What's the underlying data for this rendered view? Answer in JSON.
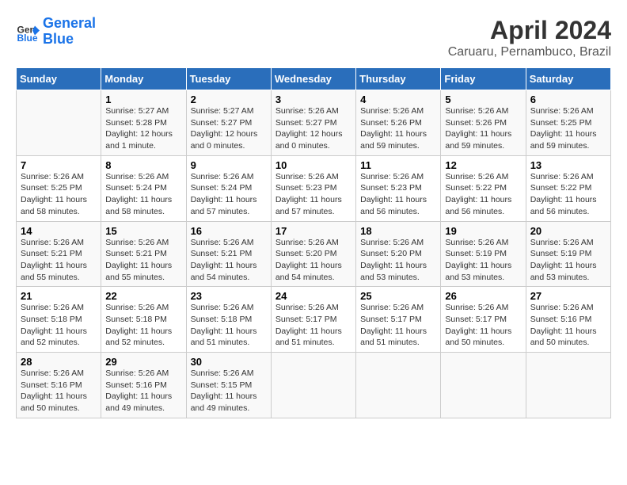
{
  "logo": {
    "line1": "General",
    "line2": "Blue"
  },
  "title": "April 2024",
  "subtitle": "Caruaru, Pernambuco, Brazil",
  "weekdays": [
    "Sunday",
    "Monday",
    "Tuesday",
    "Wednesday",
    "Thursday",
    "Friday",
    "Saturday"
  ],
  "weeks": [
    [
      {
        "day": "",
        "info": ""
      },
      {
        "day": "1",
        "info": "Sunrise: 5:27 AM\nSunset: 5:28 PM\nDaylight: 12 hours\nand 1 minute."
      },
      {
        "day": "2",
        "info": "Sunrise: 5:27 AM\nSunset: 5:27 PM\nDaylight: 12 hours\nand 0 minutes."
      },
      {
        "day": "3",
        "info": "Sunrise: 5:26 AM\nSunset: 5:27 PM\nDaylight: 12 hours\nand 0 minutes."
      },
      {
        "day": "4",
        "info": "Sunrise: 5:26 AM\nSunset: 5:26 PM\nDaylight: 11 hours\nand 59 minutes."
      },
      {
        "day": "5",
        "info": "Sunrise: 5:26 AM\nSunset: 5:26 PM\nDaylight: 11 hours\nand 59 minutes."
      },
      {
        "day": "6",
        "info": "Sunrise: 5:26 AM\nSunset: 5:25 PM\nDaylight: 11 hours\nand 59 minutes."
      }
    ],
    [
      {
        "day": "7",
        "info": "Sunrise: 5:26 AM\nSunset: 5:25 PM\nDaylight: 11 hours\nand 58 minutes."
      },
      {
        "day": "8",
        "info": "Sunrise: 5:26 AM\nSunset: 5:24 PM\nDaylight: 11 hours\nand 58 minutes."
      },
      {
        "day": "9",
        "info": "Sunrise: 5:26 AM\nSunset: 5:24 PM\nDaylight: 11 hours\nand 57 minutes."
      },
      {
        "day": "10",
        "info": "Sunrise: 5:26 AM\nSunset: 5:23 PM\nDaylight: 11 hours\nand 57 minutes."
      },
      {
        "day": "11",
        "info": "Sunrise: 5:26 AM\nSunset: 5:23 PM\nDaylight: 11 hours\nand 56 minutes."
      },
      {
        "day": "12",
        "info": "Sunrise: 5:26 AM\nSunset: 5:22 PM\nDaylight: 11 hours\nand 56 minutes."
      },
      {
        "day": "13",
        "info": "Sunrise: 5:26 AM\nSunset: 5:22 PM\nDaylight: 11 hours\nand 56 minutes."
      }
    ],
    [
      {
        "day": "14",
        "info": "Sunrise: 5:26 AM\nSunset: 5:21 PM\nDaylight: 11 hours\nand 55 minutes."
      },
      {
        "day": "15",
        "info": "Sunrise: 5:26 AM\nSunset: 5:21 PM\nDaylight: 11 hours\nand 55 minutes."
      },
      {
        "day": "16",
        "info": "Sunrise: 5:26 AM\nSunset: 5:21 PM\nDaylight: 11 hours\nand 54 minutes."
      },
      {
        "day": "17",
        "info": "Sunrise: 5:26 AM\nSunset: 5:20 PM\nDaylight: 11 hours\nand 54 minutes."
      },
      {
        "day": "18",
        "info": "Sunrise: 5:26 AM\nSunset: 5:20 PM\nDaylight: 11 hours\nand 53 minutes."
      },
      {
        "day": "19",
        "info": "Sunrise: 5:26 AM\nSunset: 5:19 PM\nDaylight: 11 hours\nand 53 minutes."
      },
      {
        "day": "20",
        "info": "Sunrise: 5:26 AM\nSunset: 5:19 PM\nDaylight: 11 hours\nand 53 minutes."
      }
    ],
    [
      {
        "day": "21",
        "info": "Sunrise: 5:26 AM\nSunset: 5:18 PM\nDaylight: 11 hours\nand 52 minutes."
      },
      {
        "day": "22",
        "info": "Sunrise: 5:26 AM\nSunset: 5:18 PM\nDaylight: 11 hours\nand 52 minutes."
      },
      {
        "day": "23",
        "info": "Sunrise: 5:26 AM\nSunset: 5:18 PM\nDaylight: 11 hours\nand 51 minutes."
      },
      {
        "day": "24",
        "info": "Sunrise: 5:26 AM\nSunset: 5:17 PM\nDaylight: 11 hours\nand 51 minutes."
      },
      {
        "day": "25",
        "info": "Sunrise: 5:26 AM\nSunset: 5:17 PM\nDaylight: 11 hours\nand 51 minutes."
      },
      {
        "day": "26",
        "info": "Sunrise: 5:26 AM\nSunset: 5:17 PM\nDaylight: 11 hours\nand 50 minutes."
      },
      {
        "day": "27",
        "info": "Sunrise: 5:26 AM\nSunset: 5:16 PM\nDaylight: 11 hours\nand 50 minutes."
      }
    ],
    [
      {
        "day": "28",
        "info": "Sunrise: 5:26 AM\nSunset: 5:16 PM\nDaylight: 11 hours\nand 50 minutes."
      },
      {
        "day": "29",
        "info": "Sunrise: 5:26 AM\nSunset: 5:16 PM\nDaylight: 11 hours\nand 49 minutes."
      },
      {
        "day": "30",
        "info": "Sunrise: 5:26 AM\nSunset: 5:15 PM\nDaylight: 11 hours\nand 49 minutes."
      },
      {
        "day": "",
        "info": ""
      },
      {
        "day": "",
        "info": ""
      },
      {
        "day": "",
        "info": ""
      },
      {
        "day": "",
        "info": ""
      }
    ]
  ]
}
